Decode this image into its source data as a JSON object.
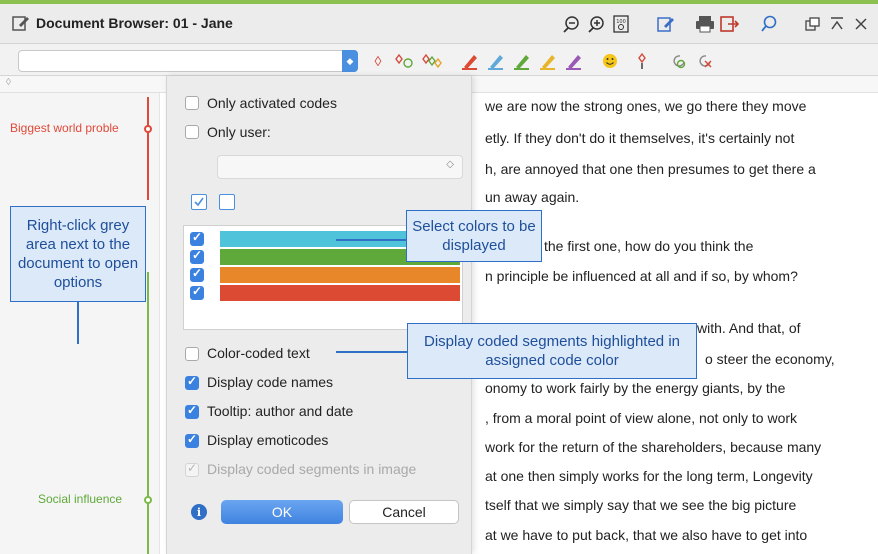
{
  "window": {
    "title": "Document Browser: 01 - Jane",
    "accent_color": "#8cc152"
  },
  "title_icons": [
    "zoom-out-icon",
    "zoom-in-icon",
    "zoom-100-icon",
    "edit-icon",
    "print-icon",
    "export-icon",
    "search-icon",
    "undock-icon",
    "pin-icon",
    "close-icon"
  ],
  "toolbar": {
    "code_select_value": "",
    "icons": [
      "code-icon",
      "code-new-icon",
      "code-multi-icon",
      "highlighter-red-icon",
      "highlighter-blue-icon",
      "highlighter-green-icon",
      "highlighter-yellow-icon",
      "highlighter-purple-icon",
      "emoticode-icon",
      "code-invivo-icon",
      "undo-code-icon",
      "remove-code-icon"
    ],
    "ruler_mark": "◊"
  },
  "gutter": {
    "codes": [
      {
        "label": "Biggest world proble",
        "color": "#e04a3a"
      },
      {
        "label": "Social influence",
        "color": "#7db84a"
      }
    ]
  },
  "options_panel": {
    "only_activated_codes": {
      "label": "Only activated codes",
      "checked": false
    },
    "only_user": {
      "label": "Only user:",
      "checked": false
    },
    "user_select_value": "",
    "color_rows": [
      {
        "color": "#4fc3d9",
        "checked": true
      },
      {
        "color": "#5fa83a",
        "checked": true
      },
      {
        "color": "#e8872a",
        "checked": true
      },
      {
        "color": "#dc4a33",
        "checked": true
      }
    ],
    "color_coded_text": {
      "label": "Color-coded text",
      "checked": false
    },
    "display_code_names": {
      "label": "Display code names",
      "checked": true
    },
    "tooltip": {
      "label": "Tooltip: author and date",
      "checked": true
    },
    "display_emoticodes": {
      "label": "Display emoticodes",
      "checked": true
    },
    "display_coded_segments_image": {
      "label": "Display coded segments in image",
      "checked": true,
      "disabled": true
    },
    "ok_label": "OK",
    "cancel_label": "Cancel"
  },
  "document_lines": [
    "we are now the strong ones, we go there they move",
    "etly. If they don't do it themselves, it's certainly not",
    "h, are annoyed that one then presumes to get there a",
    "un away again.",
    "the first one, how do you think the",
    "n principle be influenced at all and if so, by whom?",
    "with. And that, of",
    "o steer the economy,",
    "onomy to work fairly by the energy giants, by the",
    ", from a moral point of view alone, not only to work",
    "work for the return of the shareholders, because many",
    "at one then simply works for the long term, Longevity",
    "tself that we simply say that we see the big picture",
    "at we have to put back, that we also have to get into"
  ],
  "callouts": {
    "right_click": "Right-click grey area next to the document to open options",
    "select_colors": "Select colors to be displayed",
    "display_coded": "Display coded segments highlighted in assigned code color"
  }
}
